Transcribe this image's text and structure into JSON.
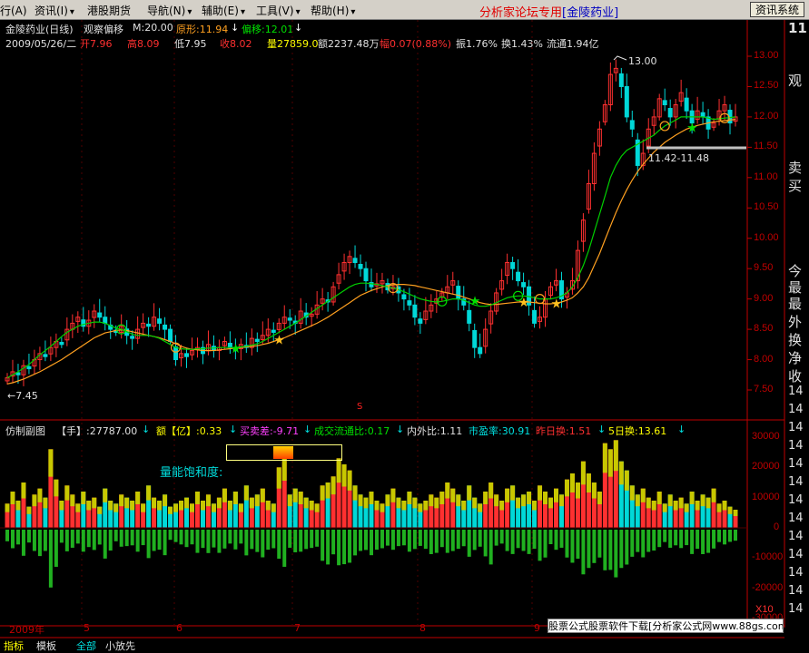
{
  "menu": {
    "items": [
      {
        "label": "行(A)"
      },
      {
        "label": "资讯(I)"
      },
      {
        "label": "港股期货"
      },
      {
        "label": "导航(N)"
      },
      {
        "label": "辅助(E)"
      },
      {
        "label": "工具(V)"
      },
      {
        "label": "帮助(H)"
      }
    ],
    "brand_text": "分析家论坛专用",
    "brand_stock": "[金陵药业]",
    "news_button": "资讯系统"
  },
  "header": {
    "title": "金陵药业(日线)",
    "indicator": "观察偏移",
    "m_value": "M:20.00",
    "yuanxing": "原形:11.94",
    "pianyi": "偏移:12.01",
    "date": "2009/05/26/二",
    "open": "开7.96",
    "high": "高8.09",
    "low": "低7.95",
    "close": "收8.02",
    "volume": "量27859.0",
    "amount": "额2237.48万",
    "change": "幅0.07(0.88%)",
    "amplitude": "振1.76%",
    "turnover": "换1.43%",
    "float": "流通1.94亿"
  },
  "annotations": {
    "peak": "13.00",
    "low": "7.45",
    "range": "11.42-11.48",
    "s_marker": "S"
  },
  "sub": {
    "name": "仿制副图",
    "hand": "【手】:27787.00",
    "amount": "额【亿】:0.33",
    "maimaicha": "买卖差:-9.71",
    "chengjiao": "成交流通比:0.17",
    "neiwai": "内外比:1.11",
    "shiyinglv": "市盈率:30.91",
    "zuorihuan": "昨日换:1.51",
    "wurihuan": "5日换:13.61",
    "saturation_label": "量能饱和度:"
  },
  "axis": {
    "price_ticks": [
      "13.00",
      "12.50",
      "12.00",
      "11.50",
      "11.00",
      "10.50",
      "10.00",
      "9.50",
      "9.00",
      "8.50",
      "8.00",
      "7.50"
    ],
    "vol_ticks": [
      "30000",
      "20000",
      "10000",
      "0",
      "-10000",
      "-20000",
      "-30000"
    ],
    "x10": "X10",
    "months": [
      "2009年",
      "5",
      "6",
      "7",
      "8",
      "9"
    ]
  },
  "right_panel": {
    "top_num": "11",
    "labels": [
      "观",
      "卖",
      "买",
      "今",
      "最",
      "最",
      "外",
      "换",
      "净",
      "收"
    ],
    "nums": [
      "14",
      "14",
      "14",
      "14",
      "14",
      "14",
      "14",
      "14",
      "14",
      "14",
      "14",
      "14",
      "14"
    ]
  },
  "footer": {
    "watermark": "股票公式股票软件下载[分析家公式网www.88gs.com]",
    "tabs": [
      "指标",
      "模板",
      "全部",
      "小放先"
    ]
  },
  "colors": {
    "up": "#ff3030",
    "down": "#00d8d8",
    "ma_green": "#00d000",
    "ma_orange": "#ffa020",
    "axis_red": "#c00000",
    "vol_yellow": "#c8c800",
    "vol_green": "#20b020"
  },
  "chart_data": {
    "type": "candlestick",
    "price_ylim": [
      7.3,
      13.3
    ],
    "volume_ylim": [
      -30000,
      33000
    ],
    "closes": [
      7.7,
      7.8,
      7.75,
      7.9,
      7.85,
      8.0,
      8.1,
      8.05,
      8.2,
      8.3,
      8.25,
      8.5,
      8.6,
      8.7,
      8.55,
      8.65,
      8.8,
      8.7,
      8.6,
      8.5,
      8.45,
      8.55,
      8.4,
      8.35,
      8.5,
      8.6,
      8.55,
      8.7,
      8.6,
      8.5,
      8.3,
      8.0,
      8.1,
      8.05,
      8.15,
      8.2,
      8.1,
      8.25,
      8.15,
      8.2,
      8.3,
      8.2,
      8.15,
      8.25,
      8.2,
      8.35,
      8.3,
      8.4,
      8.5,
      8.45,
      8.6,
      8.7,
      8.65,
      8.6,
      8.8,
      8.7,
      8.75,
      8.9,
      9.0,
      8.95,
      9.2,
      9.4,
      9.6,
      9.7,
      9.6,
      9.5,
      9.3,
      9.2,
      9.25,
      9.3,
      9.15,
      9.2,
      9.1,
      9.0,
      8.9,
      8.7,
      8.6,
      8.8,
      8.9,
      9.0,
      9.1,
      9.2,
      9.3,
      9.0,
      8.9,
      8.6,
      8.2,
      8.1,
      8.5,
      8.8,
      9.1,
      9.3,
      9.6,
      9.5,
      9.3,
      9.2,
      8.9,
      8.6,
      8.7,
      9.0,
      9.2,
      9.3,
      9.0,
      9.1,
      9.3,
      9.8,
      10.3,
      10.9,
      11.4,
      11.8,
      12.2,
      12.7,
      12.8,
      12.5,
      12.0,
      11.8,
      11.2,
      11.4,
      11.8,
      12.0,
      12.3,
      12.2,
      12.0,
      12.2,
      12.4,
      12.1,
      11.9,
      12.1,
      12.0,
      11.8,
      11.9,
      12.1,
      12.2,
      11.9,
      12.0
    ],
    "ma_green": [
      7.7,
      7.75,
      7.8,
      7.86,
      7.92,
      8.0,
      8.08,
      8.15,
      8.22,
      8.3,
      8.38,
      8.45,
      8.5,
      8.55,
      8.58,
      8.6,
      8.62,
      8.62,
      8.6,
      8.56,
      8.52,
      8.5,
      8.46,
      8.42,
      8.4,
      8.4,
      8.4,
      8.38,
      8.35,
      8.3,
      8.25,
      8.2,
      8.18,
      8.17,
      8.17,
      8.18,
      8.18,
      8.19,
      8.19,
      8.2,
      8.2,
      8.2,
      8.2,
      8.21,
      8.22,
      8.24,
      8.26,
      8.3,
      8.35,
      8.4,
      8.45,
      8.5,
      8.55,
      8.6,
      8.66,
      8.72,
      8.78,
      8.84,
      8.9,
      8.96,
      9.02,
      9.08,
      9.14,
      9.2,
      9.24,
      9.26,
      9.26,
      9.25,
      9.24,
      9.22,
      9.2,
      9.18,
      9.15,
      9.12,
      9.08,
      9.04,
      9.0,
      8.98,
      8.96,
      8.95,
      8.96,
      8.98,
      9.0,
      9.0,
      8.98,
      8.94,
      8.9,
      8.88,
      8.88,
      8.9,
      8.94,
      8.98,
      9.02,
      9.04,
      9.05,
      9.05,
      9.04,
      9.02,
      9.0,
      9.0,
      9.0,
      9.02,
      9.05,
      9.1,
      9.2,
      9.35,
      9.55,
      9.8,
      10.1,
      10.4,
      10.7,
      11.0,
      11.2,
      11.35,
      11.45,
      11.5,
      11.55,
      11.6,
      11.65,
      11.7,
      11.78,
      11.85,
      11.9,
      11.95,
      12.0,
      12.0,
      12.0,
      12.0,
      12.0,
      11.98,
      11.96,
      11.97,
      11.98,
      11.99,
      12.0
    ],
    "ma_orange": [
      7.6,
      7.62,
      7.65,
      7.68,
      7.72,
      7.76,
      7.8,
      7.85,
      7.9,
      7.95,
      8.0,
      8.06,
      8.12,
      8.18,
      8.24,
      8.3,
      8.36,
      8.4,
      8.44,
      8.46,
      8.48,
      8.49,
      8.48,
      8.46,
      8.44,
      8.42,
      8.4,
      8.38,
      8.36,
      8.33,
      8.3,
      8.26,
      8.22,
      8.19,
      8.17,
      8.16,
      8.15,
      8.15,
      8.15,
      8.16,
      8.17,
      8.18,
      8.19,
      8.2,
      8.21,
      8.22,
      8.23,
      8.25,
      8.27,
      8.3,
      8.33,
      8.36,
      8.4,
      8.44,
      8.48,
      8.52,
      8.56,
      8.6,
      8.65,
      8.7,
      8.76,
      8.82,
      8.88,
      8.94,
      9.0,
      9.06,
      9.1,
      9.14,
      9.17,
      9.2,
      9.22,
      9.23,
      9.24,
      9.24,
      9.23,
      9.22,
      9.2,
      9.18,
      9.16,
      9.14,
      9.12,
      9.1,
      9.08,
      9.06,
      9.03,
      9.0,
      8.97,
      8.94,
      8.92,
      8.91,
      8.91,
      8.92,
      8.93,
      8.94,
      8.95,
      8.95,
      8.95,
      8.94,
      8.93,
      8.92,
      8.92,
      8.93,
      8.95,
      8.98,
      9.02,
      9.1,
      9.2,
      9.35,
      9.55,
      9.75,
      9.98,
      10.2,
      10.42,
      10.62,
      10.8,
      10.96,
      11.1,
      11.22,
      11.32,
      11.42,
      11.5,
      11.58,
      11.64,
      11.7,
      11.75,
      11.8,
      11.83,
      11.86,
      11.88,
      11.9,
      11.92,
      11.93,
      11.94,
      11.95,
      11.96
    ],
    "volumes": [
      8000,
      12000,
      9000,
      15000,
      7000,
      11000,
      13000,
      10000,
      26000,
      16000,
      9000,
      14000,
      11000,
      8000,
      12000,
      9000,
      10000,
      7000,
      13000,
      9000,
      8000,
      11000,
      10000,
      9000,
      12000,
      8000,
      14000,
      10000,
      9000,
      11000,
      7000,
      8000,
      9000,
      10000,
      8000,
      12000,
      9000,
      11000,
      8000,
      10000,
      13000,
      9000,
      12000,
      8000,
      14000,
      10000,
      11000,
      13000,
      9000,
      8000,
      20000,
      24000,
      11000,
      13000,
      12000,
      10000,
      9000,
      8000,
      14000,
      15000,
      17000,
      23000,
      21000,
      19000,
      14000,
      11000,
      10000,
      12000,
      9000,
      8000,
      11000,
      13000,
      10000,
      9000,
      12000,
      10000,
      8000,
      9000,
      11000,
      10000,
      12000,
      15000,
      13000,
      11000,
      9000,
      14000,
      10000,
      8000,
      12000,
      15000,
      11000,
      9000,
      13000,
      14000,
      10000,
      11000,
      12000,
      9000,
      14000,
      12000,
      10000,
      13000,
      11000,
      16000,
      18000,
      15000,
      22000,
      18000,
      15000,
      12000,
      28000,
      26000,
      29000,
      22000,
      19000,
      14000,
      11000,
      13000,
      10000,
      9000,
      12000,
      8000,
      11000,
      9000,
      10000,
      8000,
      12000,
      9000,
      11000,
      10000,
      13000,
      8000,
      9000,
      7000,
      6000
    ]
  }
}
